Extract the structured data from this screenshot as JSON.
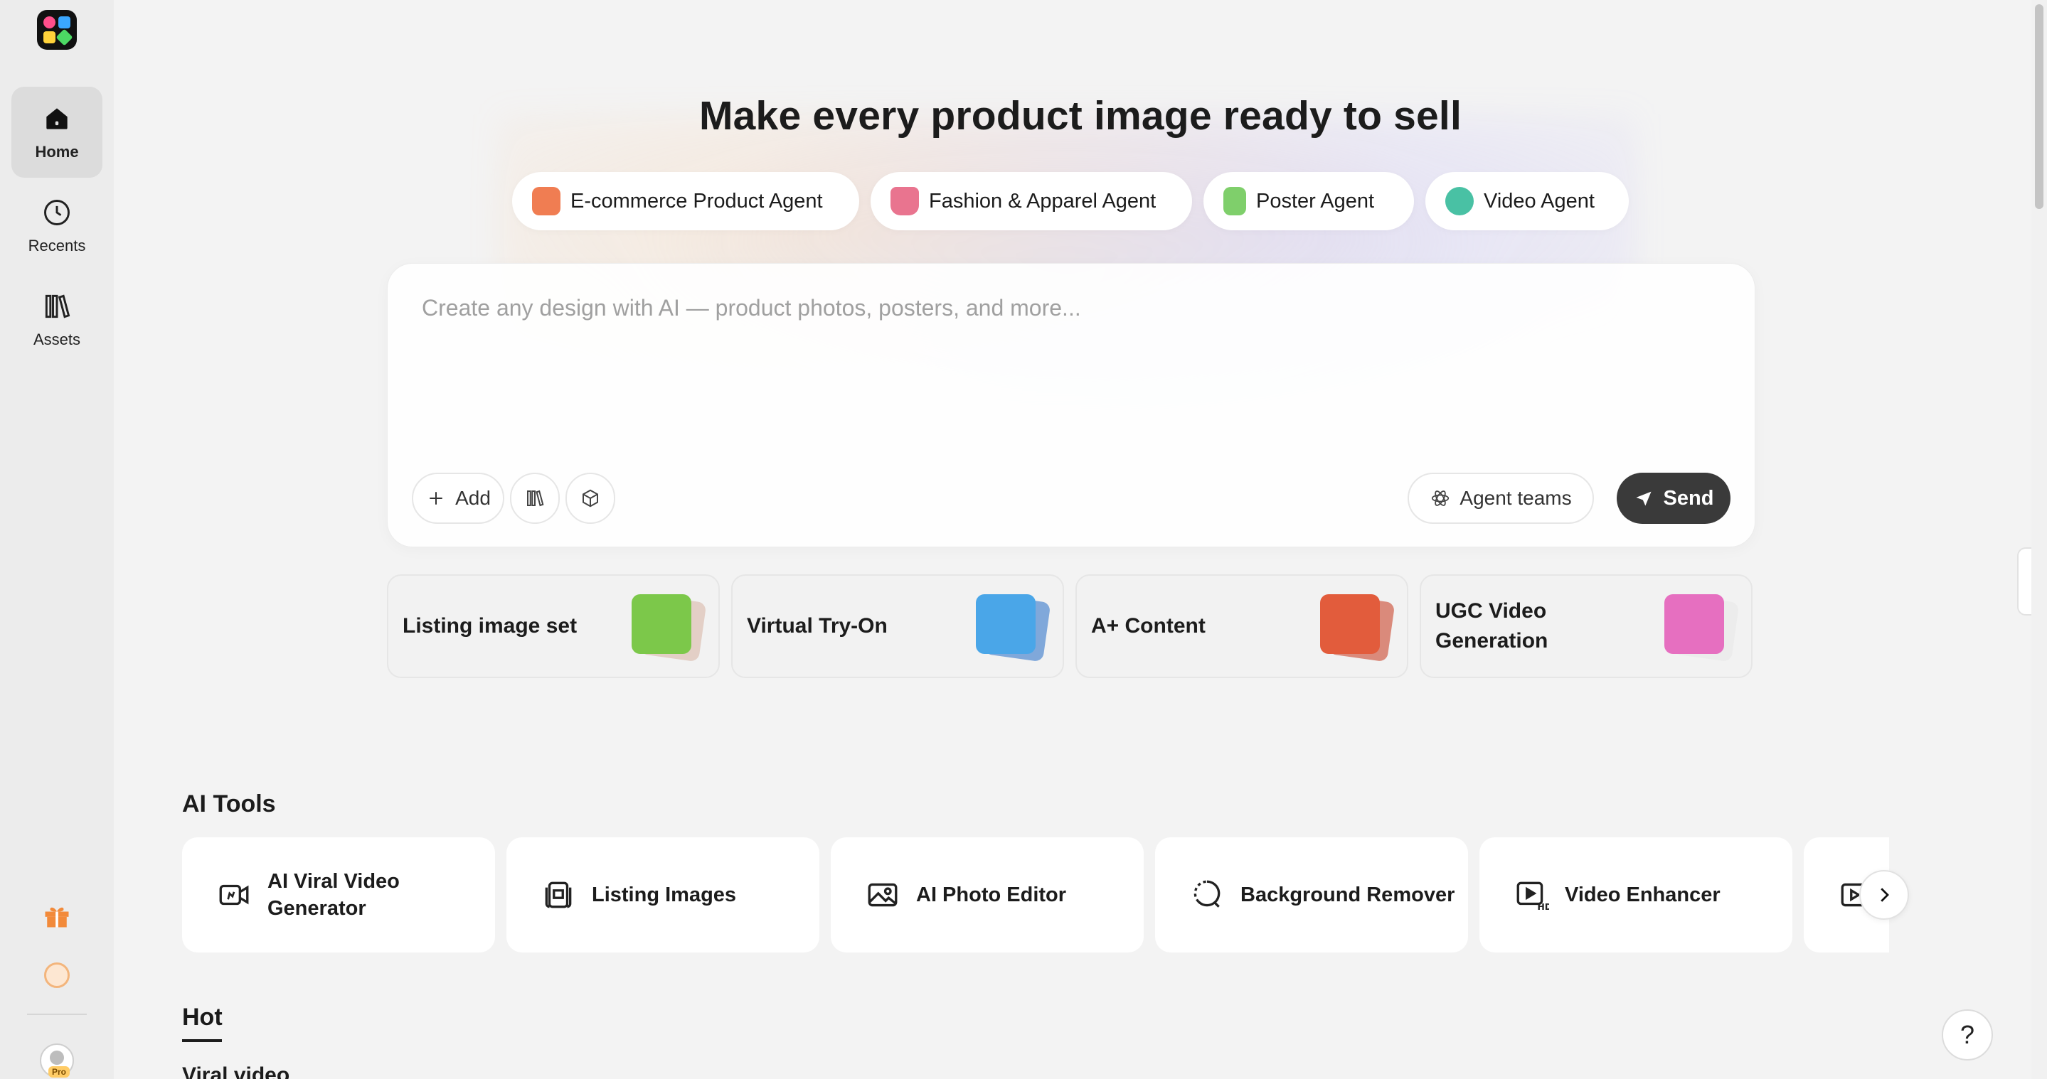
{
  "sidebar": {
    "items": [
      {
        "label": "Home",
        "icon": "home-icon",
        "active": true
      },
      {
        "label": "Recents",
        "icon": "clock-icon"
      },
      {
        "label": "Assets",
        "icon": "library-icon"
      }
    ],
    "avatar_badge": "Pro"
  },
  "hero": {
    "title": "Make every product image ready to sell"
  },
  "agents": [
    {
      "label": "E-commerce Product Agent",
      "color": "#f07d52"
    },
    {
      "label": "Fashion & Apparel Agent",
      "color": "#e9748f"
    },
    {
      "label": "Poster Agent",
      "color": "#7fcf6b"
    },
    {
      "label": "Video Agent",
      "color": "#49c1a4"
    }
  ],
  "composer": {
    "placeholder": "Create any design with AI — product photos, posters, and more...",
    "add_label": "Add",
    "agent_teams_label": "Agent teams",
    "send_label": "Send"
  },
  "quick_actions": [
    {
      "label": "Listing image set",
      "color": "#7cc84a"
    },
    {
      "label": "Virtual Try-On",
      "color": "#4aa6e8"
    },
    {
      "label": "A+ Content",
      "color": "#e25c3c"
    },
    {
      "label": "UGC Video Generation",
      "color": "#e66fc0"
    }
  ],
  "ai_tools": {
    "title": "AI Tools",
    "items": [
      {
        "label": "AI Viral Video Generator",
        "icon": "video-camera-icon"
      },
      {
        "label": "Listing Images",
        "icon": "image-stack-icon"
      },
      {
        "label": "AI Photo Editor",
        "icon": "photo-icon"
      },
      {
        "label": "Background Remover",
        "icon": "lasso-icon"
      },
      {
        "label": "Video Enhancer",
        "icon": "hd-video-icon"
      }
    ]
  },
  "hot": {
    "tab_label": "Hot",
    "subsection": "Viral video"
  },
  "help_label": "?"
}
